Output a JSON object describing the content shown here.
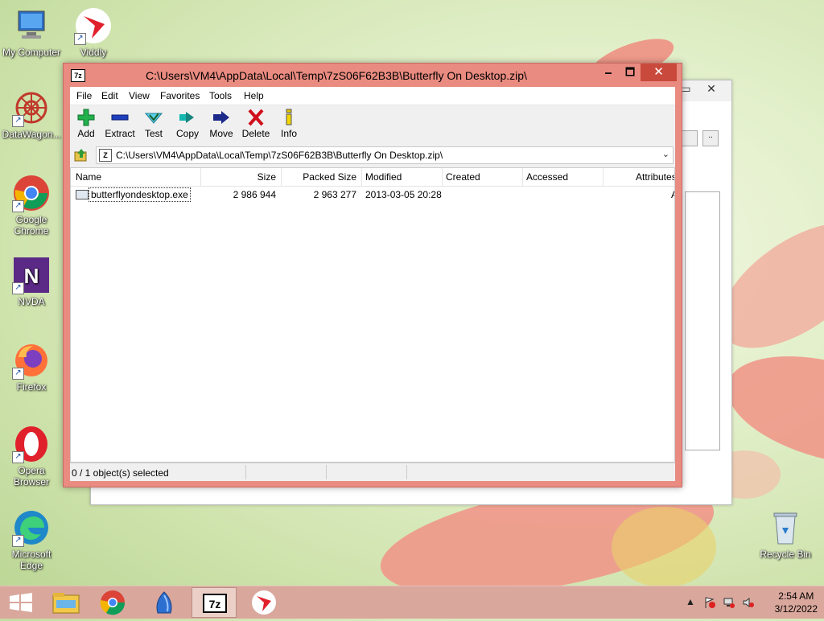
{
  "desktop": {
    "icons": [
      {
        "label": "My Computer",
        "icon": "computer-icon"
      },
      {
        "label": "Viddly",
        "icon": "viddly-icon"
      },
      {
        "label": "DataWagon...",
        "icon": "datawagon-icon"
      },
      {
        "label": "Google Chrome",
        "icon": "chrome-icon"
      },
      {
        "label": "NVDA",
        "icon": "nvda-icon"
      },
      {
        "label": "Firefox",
        "icon": "firefox-icon"
      },
      {
        "label": "Opera Browser",
        "icon": "opera-icon"
      },
      {
        "label": "Microsoft Edge",
        "icon": "edge-icon"
      },
      {
        "label": "Recycle Bin",
        "icon": "recycle-bin-icon"
      }
    ]
  },
  "window": {
    "app_icon": "7z",
    "title": "C:\\Users\\VM4\\AppData\\Local\\Temp\\7zS06F62B3B\\Butterfly On Desktop.zip\\",
    "minimize": "🗕",
    "maximize": "🗖",
    "close": "✕"
  },
  "menu": [
    "File",
    "Edit",
    "View",
    "Favorites",
    "Tools",
    "Help"
  ],
  "toolbar": [
    {
      "label": "Add",
      "icon": "add-icon"
    },
    {
      "label": "Extract",
      "icon": "extract-icon"
    },
    {
      "label": "Test",
      "icon": "test-icon"
    },
    {
      "label": "Copy",
      "icon": "copy-icon"
    },
    {
      "label": "Move",
      "icon": "move-icon"
    },
    {
      "label": "Delete",
      "icon": "delete-icon"
    },
    {
      "label": "Info",
      "icon": "info-icon"
    }
  ],
  "address": {
    "path": "C:\\Users\\VM4\\AppData\\Local\\Temp\\7zS06F62B3B\\Butterfly On Desktop.zip\\",
    "icon": "Z"
  },
  "list": {
    "columns": [
      "Name",
      "Size",
      "Packed Size",
      "Modified",
      "Created",
      "Accessed",
      "Attributes"
    ],
    "rows": [
      {
        "name": "butterflyondesktop.exe",
        "size": "2 986 944",
        "packed": "2 963 277",
        "modified": "2013-03-05 20:28",
        "created": "",
        "accessed": "",
        "attributes": "A"
      }
    ]
  },
  "status": {
    "text": "0 / 1 object(s) selected"
  },
  "taskbar": {
    "items": [
      "start-button",
      "file-explorer",
      "chrome",
      "app",
      "7-zip",
      "viddly"
    ],
    "clock_time": "2:54 AM",
    "clock_date": "3/12/2022"
  },
  "colors": {
    "window_border": "#e98b80",
    "close_button": "#c94a3c",
    "taskbar": "#d9a79c"
  }
}
